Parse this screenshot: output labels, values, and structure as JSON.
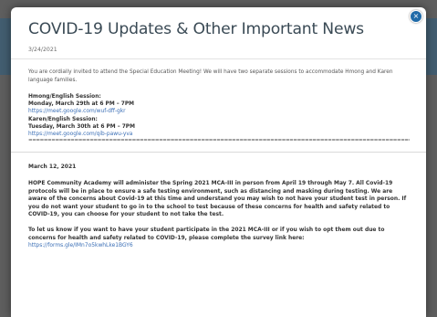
{
  "modal": {
    "title": "COVID-19 Updates & Other Important News",
    "date": "3/24/2021",
    "intro": "You are cordially invited to attend the Special Education Meeting! We will have two separate sessions to accommodate Hmong and Karen language families.",
    "hmong_heading": "Hmong/English Session:",
    "hmong_time": "Monday, March 29th at 6 PM – 7PM",
    "hmong_link": "https://meet.google.com/wuf-dff-gkr",
    "karen_heading": "Karen/English Session:",
    "karen_time": "Tuesday, March 30th at 6 PM – 7PM",
    "karen_link": "https://meet.google.com/qib-pawu-yva",
    "divider": "========================================================================================================",
    "march_date": "March 12, 2021",
    "notice": "HOPE Community Academy will administer the Spring 2021 MCA-III in person from April 19 through May 7. All Covid-19 protocols will be in place to ensure a safe testing environment, such as distancing and masking during testing. We are aware of the concerns about Covid-19 at this time and understand you may wish to not have your student test in person. If you do not want your student to go in to the school to test because of these concerns for health and safety related to COVID-19, you can choose for your student to not take the test.",
    "survey_text": "To let us know if you want to have your student participate in the 2021 MCA-III or if you wish to opt them out due to concerns for health and safety related to COVID-19, please complete the survey link here:",
    "survey_link": "https://forms.gle/IMn7o5kwhLke1BGY6",
    "close_glyph": "×"
  }
}
